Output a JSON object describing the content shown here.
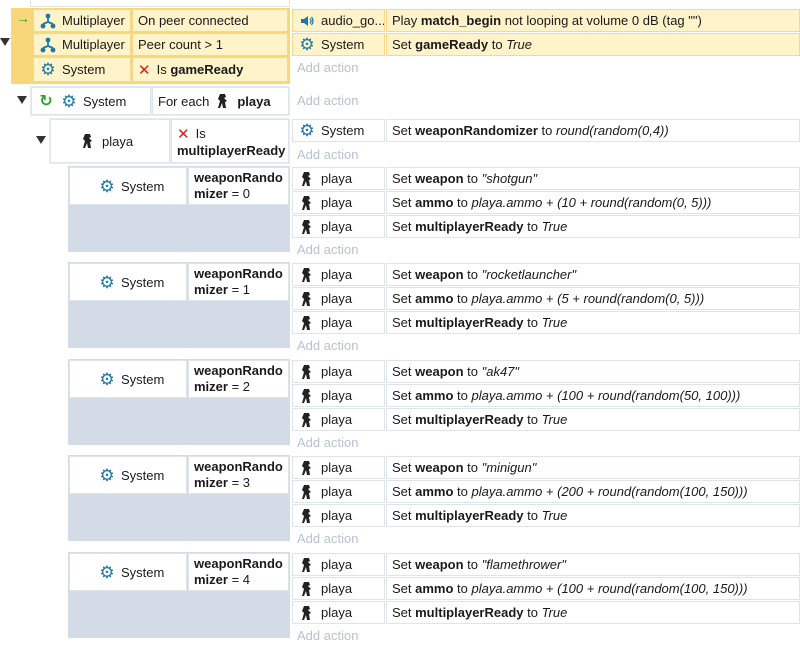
{
  "event1": {
    "conditions": [
      {
        "object": "Multiplayer",
        "icon": "multiplayer-icon",
        "text": "On peer connected"
      },
      {
        "object": "Multiplayer",
        "icon": "multiplayer-icon",
        "text": "Peer count > 1"
      },
      {
        "object": "System",
        "icon": "gear-icon",
        "inverted": true,
        "prefix": "Is",
        "bold": "gameReady"
      }
    ],
    "actions": [
      {
        "object": "audio_go...",
        "icon": "speaker-icon",
        "pre": "Play ",
        "bold": "match_begin",
        "post": " not looping at volume 0 dB (tag \"\")"
      },
      {
        "object": "System",
        "icon": "gear-icon",
        "pre": "Set ",
        "bold": "gameReady",
        "mid": " to ",
        "ital": "True"
      }
    ],
    "add_action": "Add action"
  },
  "loop": {
    "object": "System",
    "label": "For each",
    "target": "playa",
    "add_action": "Add action"
  },
  "sub": {
    "object": "playa",
    "prefix": "Is",
    "bold": "multiplayerReady",
    "action": {
      "object": "System",
      "pre": "Set ",
      "bold": "weaponRandomizer",
      "mid": " to ",
      "ital": "round(random(0,4))"
    },
    "add_action": "Add action"
  },
  "cases": [
    {
      "object": "System",
      "var_a": "weaponRando",
      "var_b": "mizer",
      "cmp": " = 0",
      "weapon": "\"shotgun\"",
      "ammo": "playa.ammo + (10 + round(random(0, 5)))"
    },
    {
      "object": "System",
      "var_a": "weaponRando",
      "var_b": "mizer",
      "cmp": " = 1",
      "weapon": "\"rocketlauncher\"",
      "ammo": "playa.ammo + (5 + round(random(0, 5)))"
    },
    {
      "object": "System",
      "var_a": "weaponRando",
      "var_b": "mizer",
      "cmp": " = 2",
      "weapon": "\"ak47\"",
      "ammo": "playa.ammo + (100 + round(random(50, 100)))"
    },
    {
      "object": "System",
      "var_a": "weaponRando",
      "var_b": "mizer",
      "cmp": " = 3",
      "weapon": "\"minigun\"",
      "ammo": "playa.ammo + (200 + round(random(100, 150)))"
    },
    {
      "object": "System",
      "var_a": "weaponRando",
      "var_b": "mizer",
      "cmp": " = 4",
      "weapon": "\"flamethrower\"",
      "ammo": "playa.ammo + (100 + round(random(100, 150)))"
    }
  ],
  "case_action": {
    "object": "playa",
    "set": "Set ",
    "to": " to ",
    "weapon_var": "weapon",
    "ammo_var": "ammo",
    "ready_var": "multiplayerReady",
    "ready_val": "True"
  },
  "add_action": "Add action",
  "colors": {
    "highlight": "#fff3c9",
    "highlight_border": "#f5d889",
    "accent": "#1e78a8",
    "panel": "#d3dbe6"
  }
}
